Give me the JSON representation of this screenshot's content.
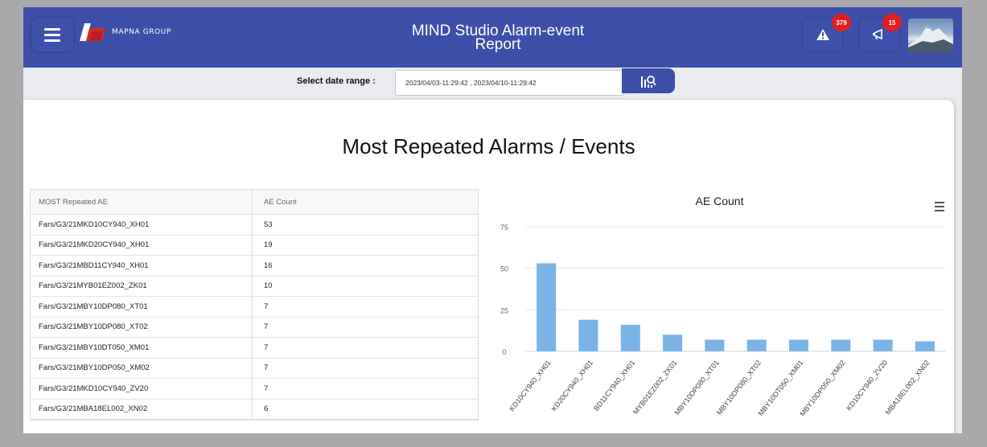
{
  "header": {
    "logo_text": "MAPNA GROUP",
    "title_line1": "MIND Studio Alarm-event",
    "title_line2": "Report",
    "alarm_count": "379",
    "notification_count": "15"
  },
  "date_range": {
    "label": "Select date range :",
    "value": "2023/04/03-11:29:42 , 2023/04/10-11:29:42"
  },
  "page_title": "Most Repeated Alarms / Events",
  "table": {
    "headers": [
      "MOST Repeated AE",
      "AE Count"
    ],
    "rows": [
      {
        "name": "Fars/G3/21MKD10CY940_XH01",
        "count": "53"
      },
      {
        "name": "Fars/G3/21MKD20CY940_XH01",
        "count": "19"
      },
      {
        "name": "Fars/G3/21MBD11CY940_XH01",
        "count": "16"
      },
      {
        "name": "Fars/G3/21MYB01EZ002_ZK01",
        "count": "10"
      },
      {
        "name": "Fars/G3/21MBY10DP080_XT01",
        "count": "7"
      },
      {
        "name": "Fars/G3/21MBY10DP080_XT02",
        "count": "7"
      },
      {
        "name": "Fars/G3/21MBY10DT050_XM01",
        "count": "7"
      },
      {
        "name": "Fars/G3/21MBY10DP050_XM02",
        "count": "7"
      },
      {
        "name": "Fars/G3/21MKD10CY940_ZV20",
        "count": "7"
      },
      {
        "name": "Fars/G3/21MBA18EL002_XN02",
        "count": "6"
      }
    ]
  },
  "colors": {
    "header_bg": "#3d4fa8",
    "bar": "#7cb3e6",
    "badge": "#e02020"
  },
  "chart_data": {
    "type": "bar",
    "title": "AE Count",
    "categories": [
      "MKD10CY940_XH01",
      "MKD20CY940_XH01",
      "MBD11CY940_XH01",
      "MYB01EZ002_ZK01",
      "MBY10DP080_XT01",
      "MBY10DP080_XT02",
      "MBY10DT050_XM01",
      "MBY10DP050_XM02",
      "MKD10CY940_ZV20",
      "MBA18EL002_XN02"
    ],
    "category_labels": [
      "KD10CY940_XH01",
      "KD20CY940_XH01",
      "BD11CY940_XH01",
      "MYB01EZ002_ZK01",
      "MBY10DP080_XT01",
      "MBY10DP080_XT02",
      "MBY10DT050_XM01",
      "MBY10DP050_XM02",
      "KD10CY940_ZV20",
      "MBA18EL002_XN02"
    ],
    "values": [
      53,
      19,
      16,
      10,
      7,
      7,
      7,
      7,
      7,
      6
    ],
    "yticks": [
      0,
      25,
      50,
      75
    ],
    "ylim": [
      0,
      75
    ],
    "grid": true,
    "legend": "none"
  }
}
